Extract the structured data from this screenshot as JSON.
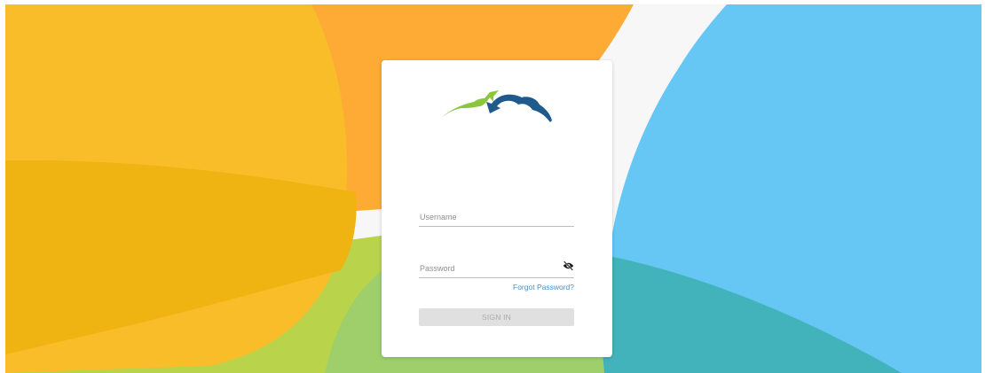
{
  "colors": {
    "orange": "#fdab35",
    "yellow": "#f9bd2a",
    "gold": "#efb411",
    "green": "#b9d34a",
    "blue": "#66c6f4",
    "teal": "#43b3bb",
    "card": "#ffffff",
    "link": "#4a8fc4",
    "button_disabled": "#e0e0e0",
    "logo_green": "#8cc63f",
    "logo_blue": "#1e5a8c"
  },
  "logo": {
    "icon": "cloud-with-arrows-logo"
  },
  "login": {
    "username": {
      "placeholder": "Username",
      "value": ""
    },
    "password": {
      "placeholder": "Password",
      "value": "",
      "visibility_icon": "eye-slash-icon"
    },
    "forgot_password": "Forgot Password?",
    "sign_in": "SIGN IN"
  }
}
